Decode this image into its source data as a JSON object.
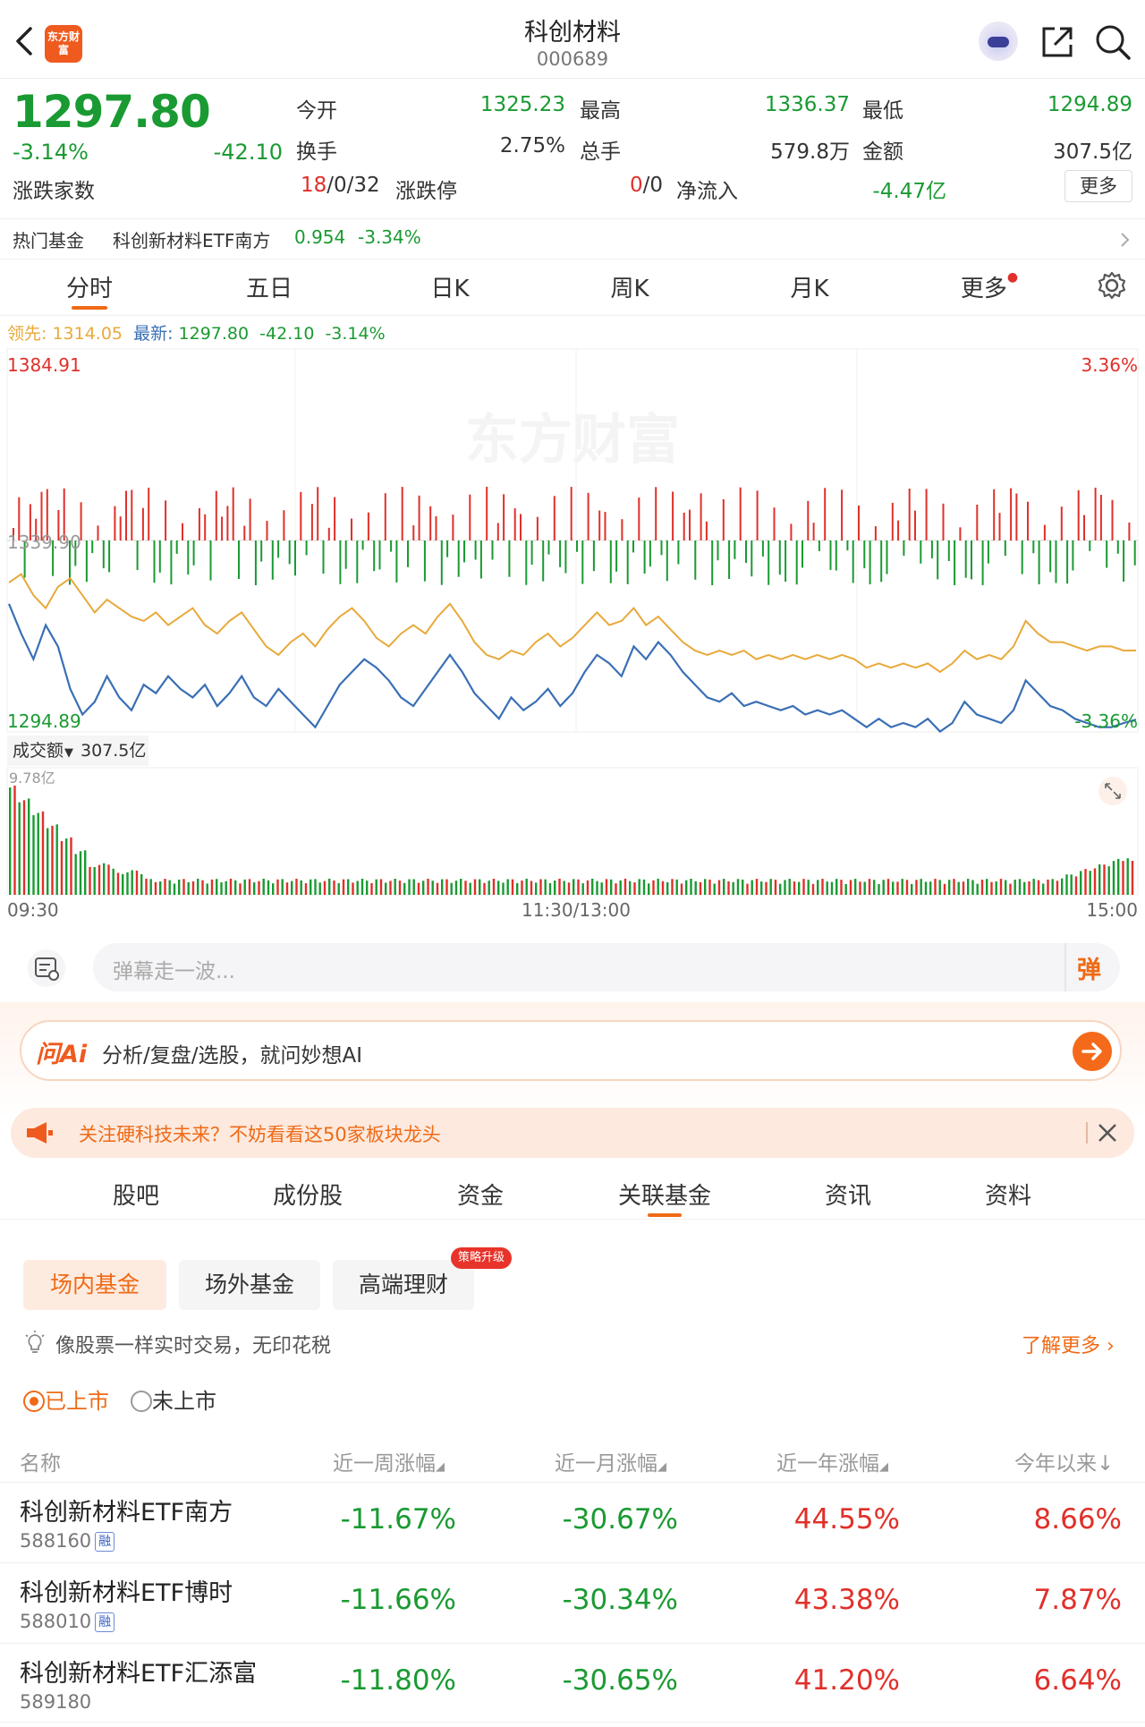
{
  "header": {
    "logo_text": "东方财富",
    "title": "科创材料",
    "code": "000689",
    "icons": [
      "back-icon",
      "eye-icon",
      "share-icon",
      "search-icon"
    ]
  },
  "quote": {
    "price": "1297.80",
    "pct": "-3.14%",
    "change": "-42.10",
    "open_label": "今开",
    "open": "1325.23",
    "high_label": "最高",
    "high": "1336.37",
    "low_label": "最低",
    "low": "1294.89",
    "turnover_label": "换手",
    "turnover": "2.75%",
    "volume_label": "总手",
    "volume": "579.8万",
    "amount_label": "金额",
    "amount": "307.5亿",
    "breadth_label": "涨跌家数",
    "breadth_up": "18",
    "breadth_rest": "/0/32",
    "limit_label": "涨跌停",
    "limit_up": "0",
    "limit_rest": "/0",
    "netflow_label": "净流入",
    "netflow": "-4.47亿",
    "more": "更多"
  },
  "hot_fund": {
    "label": "热门基金",
    "name": "科创新材料ETF南方",
    "price": "0.954",
    "pct": "-3.34%"
  },
  "chart_tabs": [
    "分时",
    "五日",
    "日K",
    "周K",
    "月K",
    "更多"
  ],
  "chart_tab_active": 0,
  "chart_legend": {
    "lead_label": "领先:",
    "lead": "1314.05",
    "latest_label": "最新:",
    "latest": "1297.80",
    "change": "-42.10",
    "pct": "-3.14%"
  },
  "chart_axes": {
    "y_max": "1384.91",
    "y_mid": "1339.90",
    "y_min": "1294.89",
    "pct_max": "3.36%",
    "pct_min": "-3.36%",
    "vol_label": "成交额",
    "vol_total": "307.5亿",
    "vol_max": "9.78亿",
    "time_start": "09:30",
    "time_mid": "11:30/13:00",
    "time_end": "15:00",
    "watermark": "东方财富"
  },
  "chart_data": {
    "type": "line",
    "ylim": [
      1294.89,
      1384.91
    ],
    "prev_close": 1339.9,
    "x": [
      "09:30",
      "11:30/13:00",
      "15:00"
    ],
    "series": [
      {
        "name": "最新",
        "color": "#3a6fb5",
        "values": [
          1325,
          1318,
          1312,
          1320,
          1315,
          1305,
          1299,
          1302,
          1308,
          1303,
          1300,
          1306,
          1304,
          1308,
          1305,
          1303,
          1306,
          1301,
          1304,
          1308,
          1303,
          1301,
          1305,
          1302,
          1299,
          1296,
          1301,
          1306,
          1309,
          1312,
          1310,
          1307,
          1303,
          1301,
          1305,
          1309,
          1313,
          1309,
          1304,
          1301,
          1298,
          1303,
          1300,
          1302,
          1305,
          1301,
          1304,
          1309,
          1313,
          1311,
          1308,
          1315,
          1312,
          1316,
          1313,
          1309,
          1306,
          1303,
          1302,
          1304,
          1301,
          1302,
          1301,
          1300,
          1301,
          1299,
          1300,
          1299,
          1300,
          1298,
          1296,
          1298,
          1296,
          1297,
          1296,
          1298,
          1295,
          1297,
          1302,
          1299,
          1298,
          1297,
          1300,
          1307,
          1304,
          1301,
          1300,
          1298,
          1297,
          1296,
          1296,
          1297,
          1297.8
        ]
      },
      {
        "name": "领先",
        "color": "#e8a93a",
        "values": [
          1330,
          1332,
          1327,
          1324,
          1329,
          1331,
          1327,
          1323,
          1326,
          1324,
          1322,
          1321,
          1323,
          1320,
          1322,
          1324,
          1320,
          1318,
          1321,
          1323,
          1319,
          1315,
          1313,
          1316,
          1318,
          1315,
          1319,
          1322,
          1324,
          1321,
          1317,
          1315,
          1318,
          1320,
          1318,
          1322,
          1325,
          1321,
          1316,
          1313,
          1312,
          1314,
          1313,
          1316,
          1318,
          1315,
          1317,
          1320,
          1323,
          1320,
          1321,
          1324,
          1320,
          1322,
          1319,
          1316,
          1314,
          1313,
          1314,
          1313,
          1314,
          1312,
          1313,
          1312,
          1313,
          1312,
          1313,
          1312,
          1313,
          1312,
          1310,
          1311,
          1310,
          1311,
          1310,
          1311,
          1309,
          1311,
          1314,
          1312,
          1313,
          1312,
          1315,
          1321,
          1318,
          1316,
          1316,
          1315,
          1314,
          1315,
          1315,
          1314,
          1314.05
        ]
      }
    ]
  },
  "danmaku": {
    "placeholder": "弹幕走一波...",
    "button": "弹"
  },
  "ai": {
    "logo": "问Ai",
    "text": "分析/复盘/选股，就问妙想AI"
  },
  "notice": {
    "text": "关注硬科技未来？不妨看看这50家板块龙头"
  },
  "section_tabs": [
    "股吧",
    "成份股",
    "资金",
    "关联基金",
    "资讯",
    "资料"
  ],
  "section_tab_active": 3,
  "fund_types": [
    "场内基金",
    "场外基金",
    "高端理财"
  ],
  "fund_type_badge": "策略升级",
  "tip": {
    "text": "像股票一样实时交易，无印花税",
    "link": "了解更多"
  },
  "listing": {
    "listed": "已上市",
    "unlisted": "未上市"
  },
  "table": {
    "headers": [
      "名称",
      "近一周涨幅",
      "近一月涨幅",
      "近一年涨幅",
      "今年以来"
    ],
    "rows": [
      {
        "name": "科创新材料ETF南方",
        "code": "588160",
        "tag": "融",
        "week": "-11.67%",
        "month": "-30.67%",
        "year": "44.55%",
        "ytd": "8.66%"
      },
      {
        "name": "科创新材料ETF博时",
        "code": "588010",
        "tag": "融",
        "week": "-11.66%",
        "month": "-30.34%",
        "year": "43.38%",
        "ytd": "7.87%"
      },
      {
        "name": "科创新材料ETF汇添富",
        "code": "589180",
        "tag": "",
        "week": "-11.80%",
        "month": "-30.65%",
        "year": "41.20%",
        "ytd": "6.64%"
      }
    ]
  },
  "colors": {
    "up": "#e0302a",
    "down": "#1a9a32",
    "accent": "#ef6a15",
    "line_price": "#3a6fb5",
    "line_avg": "#e8a93a"
  }
}
